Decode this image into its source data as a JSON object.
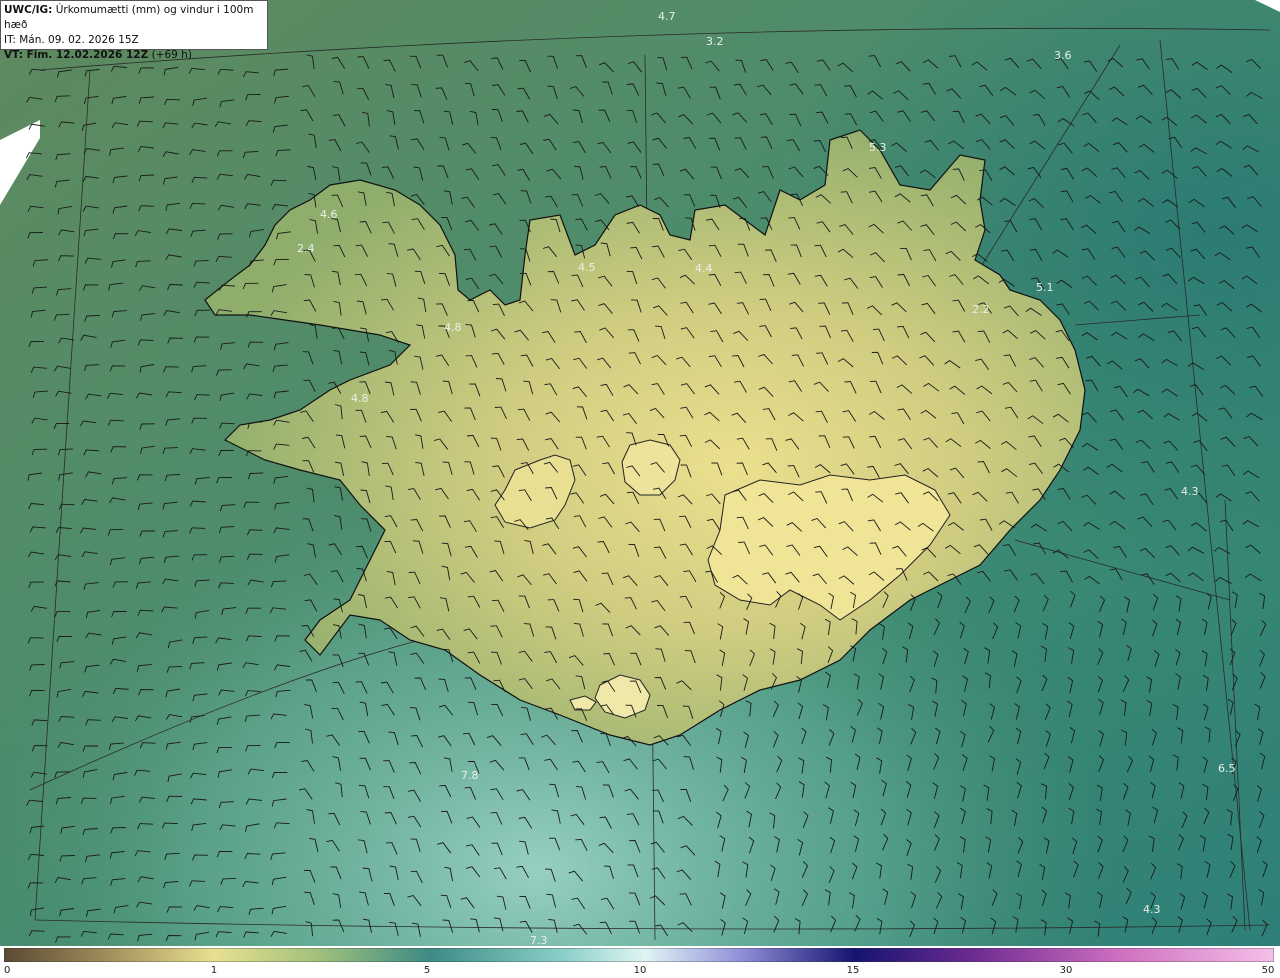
{
  "header": {
    "line1_bold": "UWC/IG:",
    "line1_rest": " Úrkomumætti (mm) og vindur i 100m hæð",
    "line2": "IT: Mán. 09. 02. 2026 15Z",
    "line3_bold": "VT: Fim. 12.02.2026 12Z",
    "line3_rest": " (+69 h)"
  },
  "legend": {
    "ticks": [
      "0",
      "1",
      "5",
      "10",
      "15",
      "30",
      "50"
    ],
    "colors": [
      "#6b5a3c",
      "#b8a46a",
      "#e8e090",
      "#7fb59a",
      "#3d8a85",
      "#d8f0f0",
      "#8080d0",
      "#1a1a80",
      "#6a2a90",
      "#d070c0",
      "#f0b0e0"
    ]
  },
  "value_labels": [
    {
      "text": "4.7"
    },
    {
      "text": "3.2"
    },
    {
      "text": "3.6"
    },
    {
      "text": "5.3"
    },
    {
      "text": "4.6"
    },
    {
      "text": "2.4"
    },
    {
      "text": "4.5"
    },
    {
      "text": "4.4"
    },
    {
      "text": "5.1"
    },
    {
      "text": "2.2"
    },
    {
      "text": "4.8"
    },
    {
      "text": "4.8"
    },
    {
      "text": "4.3"
    },
    {
      "text": "7.8"
    },
    {
      "text": "6.5"
    },
    {
      "text": "4.3"
    },
    {
      "text": "7.3"
    }
  ],
  "colors": {
    "ocean_dark": "#2e7a62",
    "ocean_mid": "#4d9070",
    "land_low": "#8aab6a",
    "land_high": "#e6dc8a",
    "coast": "#1a1a1a",
    "grid": "#333333"
  }
}
